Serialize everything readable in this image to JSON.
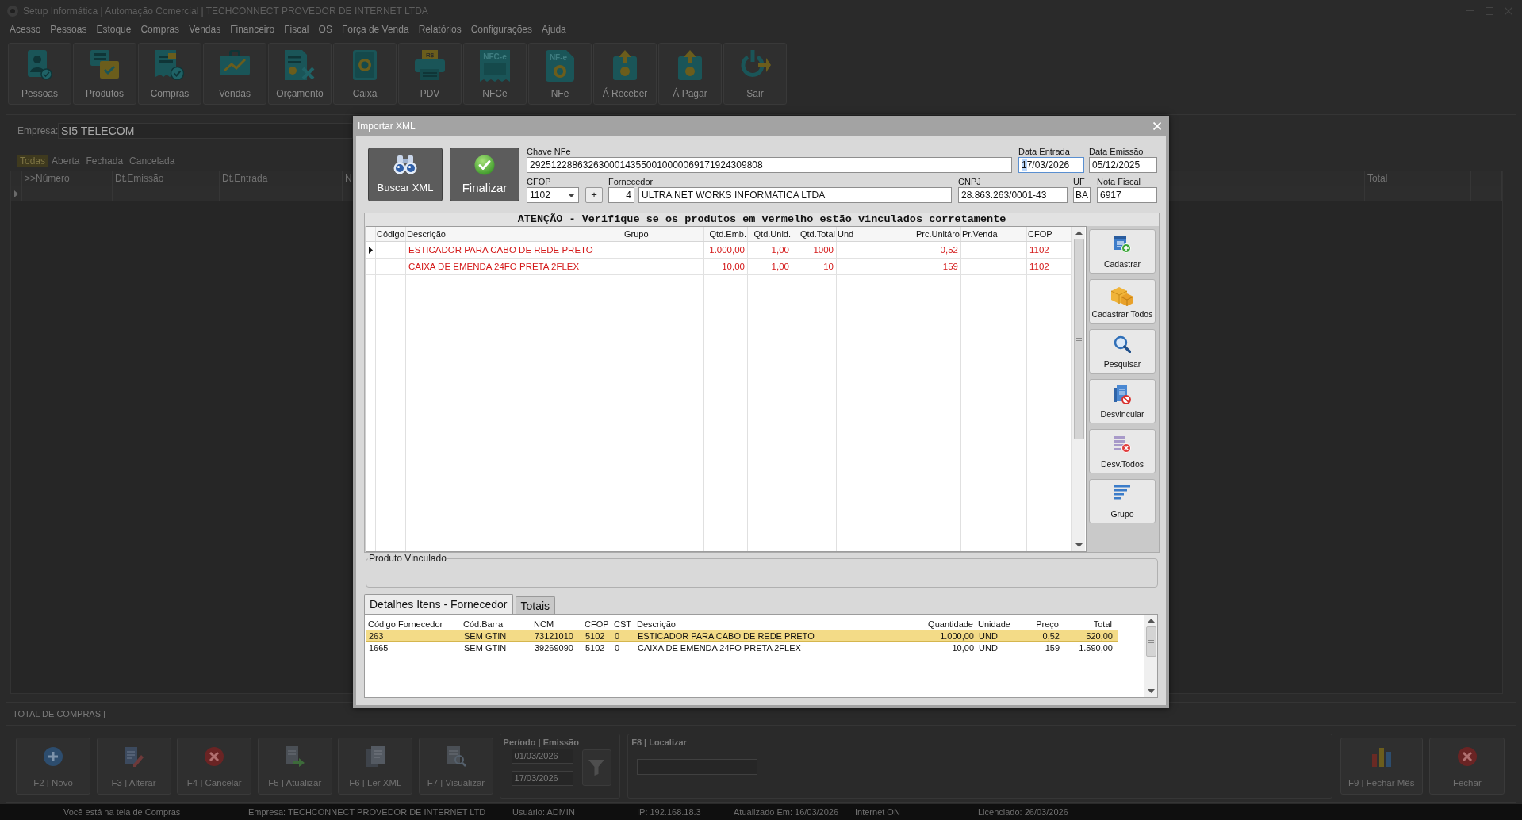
{
  "window": {
    "title": "Setup Informática | Automação Comercial | TECHCONNECT PROVEDOR DE INTERNET LTDA"
  },
  "menu": [
    "Acesso",
    "Pessoas",
    "Estoque",
    "Compras",
    "Vendas",
    "Financeiro",
    "Fiscal",
    "OS",
    "Força de Venda",
    "Relatórios",
    "Configurações",
    "Ajuda"
  ],
  "toolbar": [
    {
      "label": "Pessoas"
    },
    {
      "label": "Produtos"
    },
    {
      "label": "Compras"
    },
    {
      "label": "Vendas"
    },
    {
      "label": "Orçamento"
    },
    {
      "label": "Caixa"
    },
    {
      "label": "PDV",
      "icon_text": "R$"
    },
    {
      "label": "NFCe",
      "icon_text": "NFC-e"
    },
    {
      "label": "NFe",
      "icon_text": "NF-e"
    },
    {
      "label": "Á Receber"
    },
    {
      "label": "Á Pagar"
    },
    {
      "label": "Sair"
    }
  ],
  "company": {
    "label": "Empresa:",
    "value": "SI5 TELECOM"
  },
  "status_tabs": [
    {
      "label": "Todas",
      "selected": true
    },
    {
      "label": "Aberta",
      "selected": false
    },
    {
      "label": "Fechada",
      "selected": false
    },
    {
      "label": "Cancelada",
      "selected": false
    }
  ],
  "purchases_table": {
    "columns": [
      ">>Número",
      "Dt.Emissão",
      "Dt.Entrada",
      "N",
      "Total"
    ],
    "rows": [
      {
        "current": true
      }
    ]
  },
  "total_label": "TOTAL DE COMPRAS |",
  "actions": [
    {
      "label": "F2 | Novo"
    },
    {
      "label": "F3 | Alterar"
    },
    {
      "label": "F4 | Cancelar"
    },
    {
      "label": "F5 | Atualizar"
    },
    {
      "label": "F6 | Ler XML"
    },
    {
      "label": "F7 | Visualizar"
    }
  ],
  "period": {
    "label": "Período | Emissão",
    "from": "01/03/2026",
    "to": "17/03/2026"
  },
  "locate": {
    "label": "F8 | Localizar"
  },
  "end_actions": [
    {
      "label": "F9 | Fechar Mês"
    },
    {
      "label": "Fechar"
    }
  ],
  "status_bar": [
    "Você está na tela de Compras",
    "Empresa: TECHCONNECT PROVEDOR DE INTERNET LTD",
    "Usuário: ADMIN",
    "IP: 192.168.18.3",
    "Atualizado Em: 16/03/2026",
    "Internet ON",
    "Licenciado: 26/03/2026"
  ],
  "dialog": {
    "title": "Importar XML",
    "buttons": [
      {
        "label": "Buscar XML"
      },
      {
        "label": "Finalizar"
      }
    ],
    "access_key": {
      "label": "Chave NFe",
      "value": "29251228863263000143550010000069171924309808"
    },
    "entry_date": {
      "label": "Data Entrada",
      "value": "17/03/2026",
      "focused": true
    },
    "issue_date": {
      "label": "Data Emissão",
      "value": "05/12/2025"
    },
    "cfop": {
      "label": "CFOP",
      "value": "1102"
    },
    "add_button": {
      "label": "+"
    },
    "supplier": {
      "label": "Fornecedor",
      "code": "4",
      "name": "ULTRA NET WORKS INFORMATICA LTDA"
    },
    "cnpj": {
      "label": "CNPJ",
      "value": "28.863.263/0001-43"
    },
    "uf": {
      "label": "UF",
      "value": "BA"
    },
    "invoice": {
      "label": "Nota Fiscal",
      "value": "6917"
    },
    "notice": "ATENÇÃO - Verifique se os produtos em vermelho estão vinculados corretamente",
    "items_table": {
      "columns": [
        "Código",
        "Descrição",
        "Grupo",
        "Qtd.Emb.",
        "Qtd.Unid.",
        "Qtd.Total",
        "Und",
        "Prc.Unitáro",
        "Pr.Venda",
        "CFOP"
      ],
      "rows": [
        {
          "current": true,
          "unlinked": true,
          "description": "ESTICADOR PARA CABO DE REDE PRETO",
          "qty_pack": "1.000,00",
          "qty_unit": "1,00",
          "qty_total": "1000",
          "unit_price": "0,52",
          "cfop": "1102"
        },
        {
          "current": false,
          "unlinked": true,
          "description": "CAIXA DE EMENDA 24FO PRETA 2FLEX",
          "qty_pack": "10,00",
          "qty_unit": "1,00",
          "qty_total": "10",
          "unit_price": "159",
          "cfop": "1102"
        }
      ]
    },
    "side_buttons": [
      {
        "label": "Cadastrar"
      },
      {
        "label": "Cadastrar Todos"
      },
      {
        "label": "Pesquisar"
      },
      {
        "label": "Desvincular"
      },
      {
        "label": "Desv.Todos"
      },
      {
        "label": "Grupo"
      }
    ],
    "linked_product": {
      "label": "Produto Vinculado"
    },
    "tabs": [
      {
        "label": "Detalhes Itens - Fornecedor",
        "selected": true
      },
      {
        "label": "Totais",
        "selected": false
      }
    ],
    "details_table": {
      "columns": [
        "Código Fornecedor",
        "Cód.Barra",
        "NCM",
        "CFOP",
        "CST",
        "Descrição",
        "Quantidade",
        "Unidade",
        "Preço",
        "Total"
      ],
      "rows": [
        {
          "selected": true,
          "cells": [
            "263",
            "SEM GTIN",
            "73121010",
            "5102",
            "0",
            "ESTICADOR PARA CABO DE REDE PRETO",
            "1.000,00",
            "UND",
            "0,52",
            "520,00"
          ]
        },
        {
          "selected": false,
          "cells": [
            "1665",
            "SEM GTIN",
            "39269090",
            "5102",
            "0",
            "CAIXA DE EMENDA 24FO PRETA 2FLEX",
            "10,00",
            "UND",
            "159",
            "1.590,00"
          ]
        }
      ]
    }
  }
}
